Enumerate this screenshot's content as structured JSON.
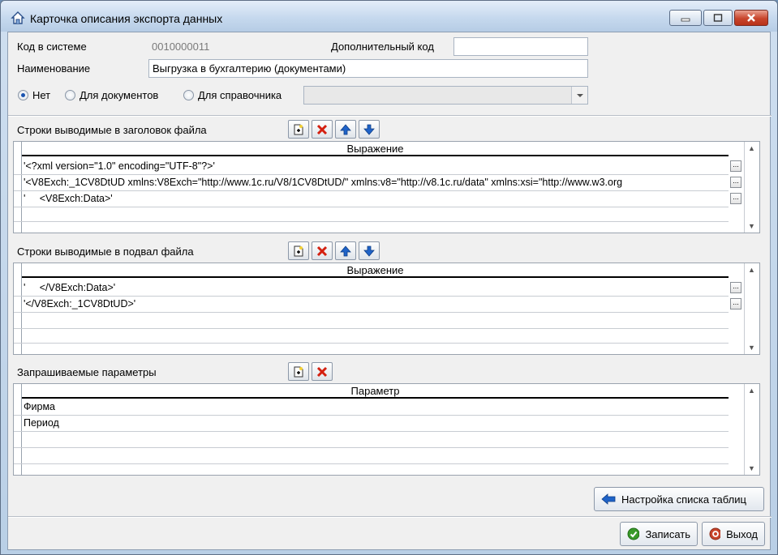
{
  "window": {
    "title": "Карточка описания экспорта данных",
    "icon": "home-export-icon",
    "controls": {
      "minimize": "minimize-icon",
      "maximize": "maximize-icon",
      "close": "close-icon"
    }
  },
  "form": {
    "code_label": "Код в системе",
    "code_value": "0010000011",
    "extra_code_label": "Дополнительный код",
    "extra_code_value": "",
    "name_label": "Наименование",
    "name_value": "Выгрузка  в бухгалтерию (документами)",
    "radio_options": [
      {
        "label": "Нет",
        "selected": true
      },
      {
        "label": "Для документов",
        "selected": false
      },
      {
        "label": "Для справочника",
        "selected": false
      }
    ],
    "reference_select_value": ""
  },
  "header_section": {
    "title": "Строки выводимые в заголовок файла",
    "column": "Выражение",
    "rows": [
      "'<?xml version=\"1.0\" encoding=\"UTF-8\"?>'",
      "'<V8Exch:_1CV8DtUD xmlns:V8Exch=\"http://www.1c.ru/V8/1CV8DtUD/\" xmlns:v8=\"http://v8.1c.ru/data\" xmlns:xsi=\"http://www.w3.org",
      "'     <V8Exch:Data>'"
    ],
    "ellipsis": "..."
  },
  "footer_section": {
    "title": "Строки выводимые в подвал файла",
    "column": "Выражение",
    "rows": [
      "'     </V8Exch:Data>'",
      "'</V8Exch:_1CV8DtUD>'"
    ],
    "ellipsis": "..."
  },
  "params_section": {
    "title": "Запрашиваемые параметры",
    "column": "Параметр",
    "rows": [
      "Фирма",
      "Период"
    ]
  },
  "buttons": {
    "table_setup": "Настройка списка таблиц",
    "save": "Записать",
    "exit": "Выход"
  },
  "colors": {
    "delete_red": "#d42010",
    "arrow_blue": "#1f63c8",
    "save_green": "#3a9a2a",
    "exit_red": "#c8452c"
  }
}
